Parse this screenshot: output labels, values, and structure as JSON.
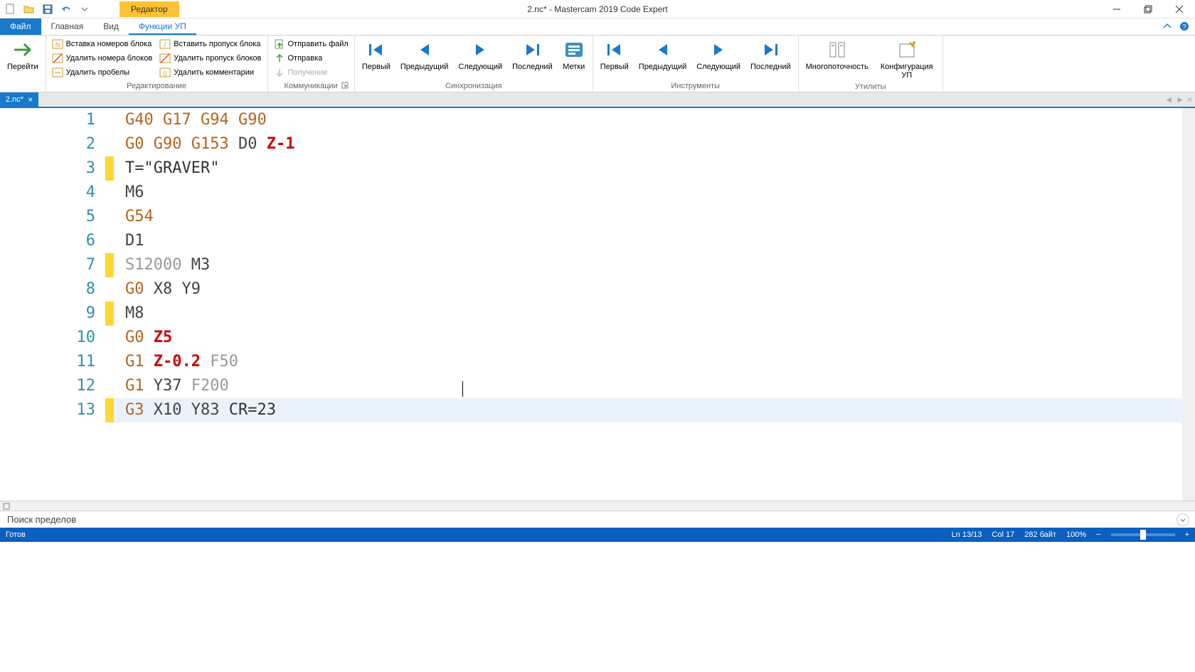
{
  "title": "2.nc* - Mastercam 2019 Code Expert",
  "editor_header_tab": "Редактор",
  "ribbon_tabs": {
    "file": "Файл",
    "home": "Главная",
    "view": "Вид",
    "nc_functions": "Функции УП"
  },
  "ribbon": {
    "go_to": "Перейти",
    "group_edit": {
      "insert_block_numbers": "Вставка номеров блока",
      "remove_block_numbers": "Удалить номера блоков",
      "remove_spaces": "Удалить пробелы",
      "insert_block_skip": "Вставить пропуск блока",
      "remove_block_skip": "Удалить пропуск блоков",
      "remove_comments": "Удалить комментарии",
      "label": "Редактирование"
    },
    "group_comm": {
      "send_file": "Отправить файл",
      "send": "Отправка",
      "receive": "Получение",
      "label": "Коммуникации"
    },
    "group_sync": {
      "first": "Первый",
      "prev": "Предыдущий",
      "next": "Следующий",
      "last": "Последний",
      "marks": "Метки",
      "label": "Синхронизация"
    },
    "group_tools": {
      "first": "Первый",
      "prev": "Предыдущий",
      "next": "Следующий",
      "last": "Последний",
      "label": "Инструменты"
    },
    "group_util": {
      "multithread": "Многопоточность",
      "config": "Конфигурация УП",
      "label": "Утилиты"
    }
  },
  "doc_tab": "2.nc*",
  "code_lines": [
    {
      "n": 1,
      "marked": false,
      "tokens": [
        [
          "g",
          "G40"
        ],
        [
          "sp",
          " "
        ],
        [
          "g",
          "G17"
        ],
        [
          "sp",
          " "
        ],
        [
          "g",
          "G94"
        ],
        [
          "sp",
          " "
        ],
        [
          "g",
          "G90"
        ]
      ]
    },
    {
      "n": 2,
      "marked": false,
      "tokens": [
        [
          "g",
          "G0"
        ],
        [
          "sp",
          " "
        ],
        [
          "g",
          "G90"
        ],
        [
          "sp",
          " "
        ],
        [
          "g",
          "G153"
        ],
        [
          "sp",
          " "
        ],
        [
          "coord",
          "D0"
        ],
        [
          "sp",
          " "
        ],
        [
          "z",
          "Z-1"
        ]
      ]
    },
    {
      "n": 3,
      "marked": true,
      "tokens": [
        [
          "str",
          "T=\"GRAVER\""
        ]
      ]
    },
    {
      "n": 4,
      "marked": false,
      "tokens": [
        [
          "m",
          "M6"
        ]
      ]
    },
    {
      "n": 5,
      "marked": false,
      "tokens": [
        [
          "g",
          "G54"
        ]
      ]
    },
    {
      "n": 6,
      "marked": false,
      "tokens": [
        [
          "coord",
          "D1"
        ]
      ]
    },
    {
      "n": 7,
      "marked": true,
      "tokens": [
        [
          "s",
          "S12000"
        ],
        [
          "sp",
          " "
        ],
        [
          "m",
          "M3"
        ]
      ]
    },
    {
      "n": 8,
      "marked": false,
      "tokens": [
        [
          "g",
          "G0"
        ],
        [
          "sp",
          " "
        ],
        [
          "coord",
          "X8"
        ],
        [
          "sp",
          " "
        ],
        [
          "coord",
          "Y9"
        ]
      ]
    },
    {
      "n": 9,
      "marked": true,
      "tokens": [
        [
          "m",
          "M8"
        ]
      ]
    },
    {
      "n": 10,
      "marked": false,
      "tokens": [
        [
          "g",
          "G0"
        ],
        [
          "sp",
          " "
        ],
        [
          "z",
          "Z5"
        ]
      ]
    },
    {
      "n": 11,
      "marked": false,
      "tokens": [
        [
          "g",
          "G1"
        ],
        [
          "sp",
          " "
        ],
        [
          "z",
          "Z-0.2"
        ],
        [
          "sp",
          " "
        ],
        [
          "f",
          "F50"
        ]
      ]
    },
    {
      "n": 12,
      "marked": false,
      "tokens": [
        [
          "g",
          "G1"
        ],
        [
          "sp",
          " "
        ],
        [
          "coord",
          "Y37"
        ],
        [
          "sp",
          " "
        ],
        [
          "f",
          "F200"
        ]
      ]
    },
    {
      "n": 13,
      "marked": true,
      "current": true,
      "tokens": [
        [
          "g",
          "G3"
        ],
        [
          "sp",
          " "
        ],
        [
          "coord",
          "X10"
        ],
        [
          "sp",
          " "
        ],
        [
          "coord",
          "Y83"
        ],
        [
          "sp",
          " "
        ],
        [
          "cr",
          "CR=23"
        ]
      ]
    }
  ],
  "search_panel": "Поиск пределов",
  "status": {
    "ready": "Готов",
    "ln": "Ln 13/13",
    "col": "Col 17",
    "bytes": "282 байт",
    "zoom": "100%"
  }
}
